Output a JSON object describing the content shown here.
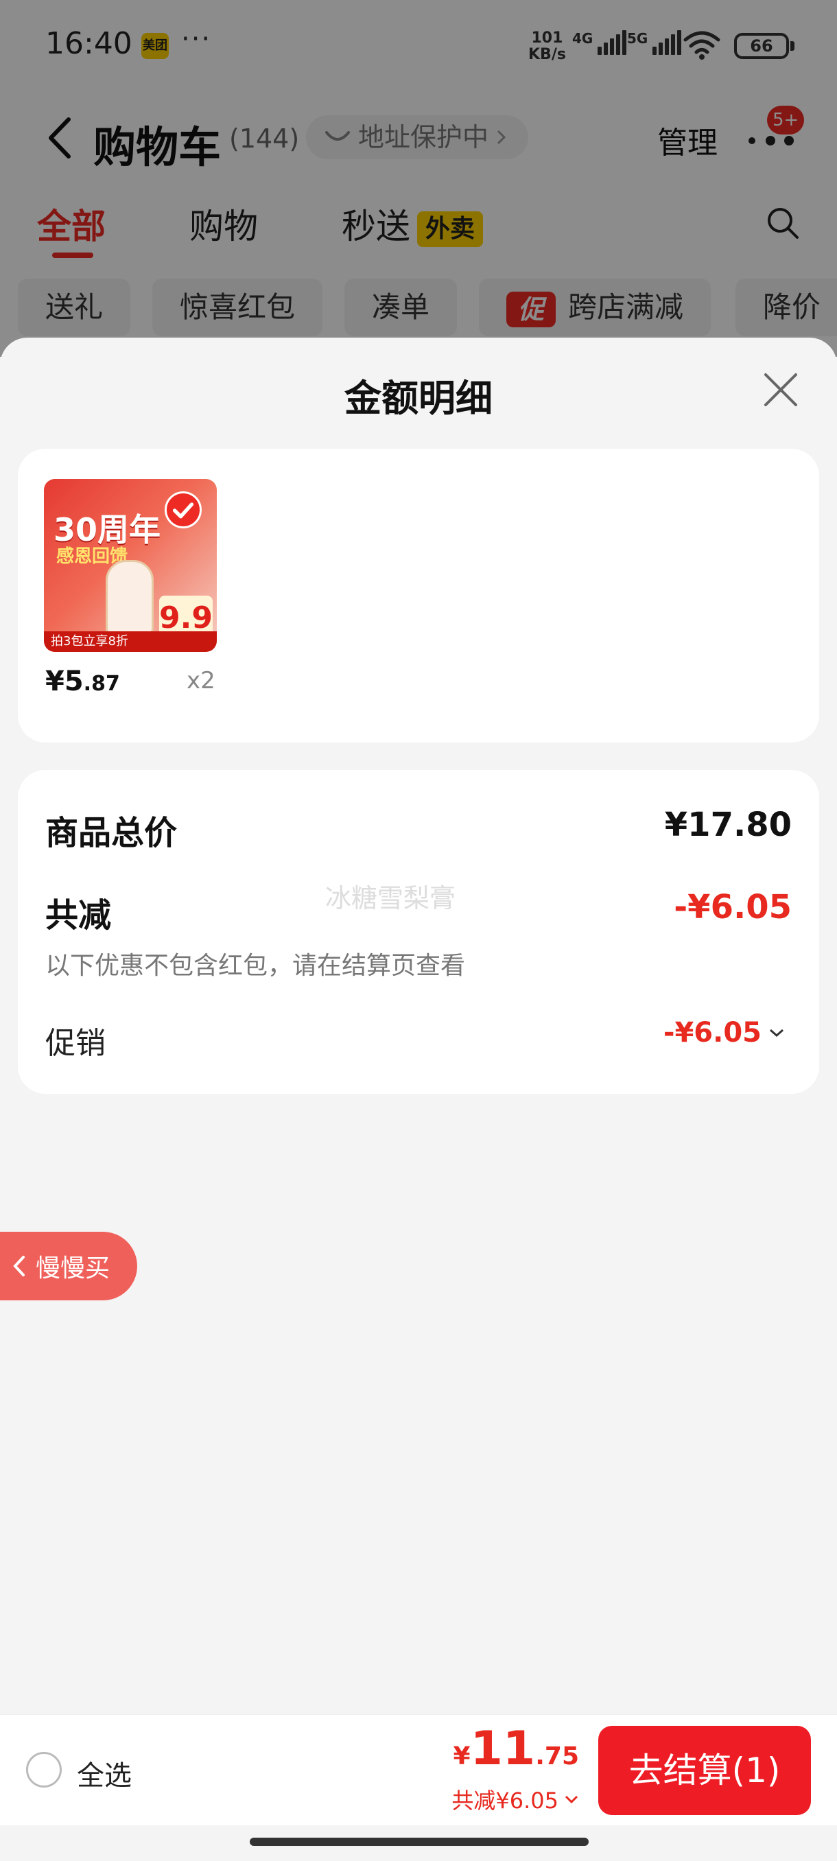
{
  "status_bar": {
    "time": "16:40",
    "app_badge": "美团",
    "dots": "···",
    "speed_value": "101",
    "speed_unit": "KB/s",
    "net1": "4G",
    "net2": "5G",
    "battery": "66"
  },
  "nav": {
    "title": "购物车",
    "count": "(144)",
    "address_pill": "地址保护中",
    "manage": "管理",
    "badge": "5+"
  },
  "tabs": [
    {
      "label": "全部"
    },
    {
      "label": "购物"
    },
    {
      "label": "秒送",
      "tag": "外卖"
    }
  ],
  "chips": [
    {
      "label": "送礼"
    },
    {
      "label": "惊喜红包"
    },
    {
      "label": "凑单"
    },
    {
      "label": "跨店满减",
      "tag": "促"
    },
    {
      "label": "降价"
    }
  ],
  "sheet": {
    "title": "金额明细",
    "product": {
      "image_text": {
        "headline": "30周年",
        "sub": "感恩回馈",
        "price": "9.9",
        "banner": "拍3包立享8折"
      },
      "price_int": "¥5",
      "price_dec": ".87",
      "quantity": "x2"
    },
    "summary": {
      "total_label": "商品总价",
      "total_value": "¥17.80",
      "discount_label": "共减",
      "discount_value": "-¥6.05",
      "hint": "以下优惠不包含红包，请在结算页查看",
      "promo_label": "促销",
      "promo_value": "-¥6.05",
      "watermark": "冰糖雪梨膏"
    }
  },
  "slow_buy": "慢慢买",
  "bottom_bar": {
    "select_all": "全选",
    "total_yen": "¥",
    "total_int": "11",
    "total_dec": ".75",
    "discount_text": "共减¥6.05",
    "checkout": "去结算(1)"
  },
  "colors": {
    "accent": "#ee2a24",
    "checkout": "#ee1c25",
    "price_red": "#e7291f",
    "tag_yellow": "#ffd100"
  }
}
